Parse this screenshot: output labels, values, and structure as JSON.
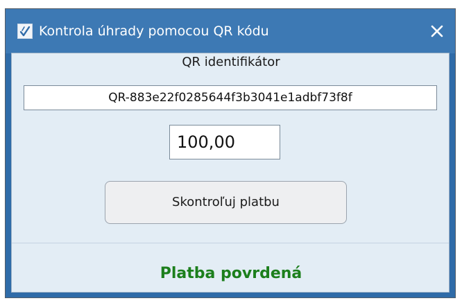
{
  "window": {
    "title": "Kontrola úhrady pomocou QR kódu",
    "icon": "check-app-icon",
    "close_icon": "close-icon"
  },
  "form": {
    "qr_label": "QR identifikátor",
    "qr_value": "QR-883e22f0285644f3b3041e1adbf73f8f",
    "amount_value": "100,00",
    "check_button_label": "Skontroľuj platbu"
  },
  "status": {
    "message": "Platba povrdená",
    "color": "#1c7f1c"
  },
  "colors": {
    "titlebar": "#3d79b4",
    "client_background": "#e3edf5"
  }
}
